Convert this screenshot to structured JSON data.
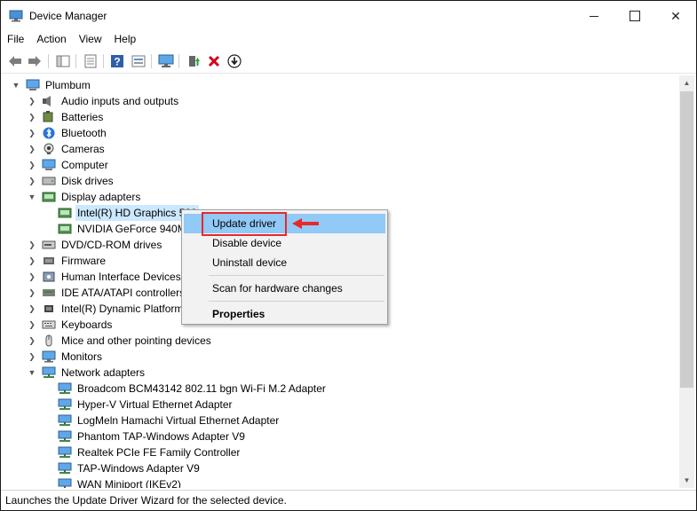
{
  "window": {
    "title": "Device Manager",
    "minimize_glyph": "",
    "maximize_glyph": "",
    "close_glyph": "✕"
  },
  "menu": [
    "File",
    "Action",
    "View",
    "Help"
  ],
  "toolbar": {
    "icons": [
      "back-icon",
      "forward-icon",
      "show-hide-tree-icon",
      "properties-icon",
      "help-icon",
      "view-icon",
      "scan-hardware-icon",
      "update-driver-icon",
      "uninstall-icon",
      "disable-icon"
    ]
  },
  "tree": {
    "root": "Plumbum",
    "categories": [
      {
        "label": "Audio inputs and outputs",
        "icon": "speaker-icon",
        "expanded": false
      },
      {
        "label": "Batteries",
        "icon": "battery-icon",
        "expanded": false
      },
      {
        "label": "Bluetooth",
        "icon": "bluetooth-icon",
        "expanded": false
      },
      {
        "label": "Cameras",
        "icon": "camera-icon",
        "expanded": false
      },
      {
        "label": "Computer",
        "icon": "computer-icon",
        "expanded": false
      },
      {
        "label": "Disk drives",
        "icon": "disk-icon",
        "expanded": false
      },
      {
        "label": "Display adapters",
        "icon": "display-adapter-icon",
        "expanded": true,
        "children": [
          "Intel(R) HD Graphics 520",
          "NVIDIA GeForce 940M"
        ]
      },
      {
        "label": "DVD/CD-ROM drives",
        "icon": "dvd-icon",
        "expanded": false
      },
      {
        "label": "Firmware",
        "icon": "firmware-icon",
        "expanded": false
      },
      {
        "label": "Human Interface Devices",
        "icon": "hid-icon",
        "expanded": false
      },
      {
        "label": "IDE ATA/ATAPI controllers",
        "icon": "ide-icon",
        "expanded": false
      },
      {
        "label": "Intel(R) Dynamic Platform",
        "icon": "chip-icon",
        "expanded": false
      },
      {
        "label": "Keyboards",
        "icon": "keyboard-icon",
        "expanded": false
      },
      {
        "label": "Mice and other pointing devices",
        "icon": "mouse-icon",
        "expanded": false
      },
      {
        "label": "Monitors",
        "icon": "monitor-icon",
        "expanded": false
      },
      {
        "label": "Network adapters",
        "icon": "network-icon",
        "expanded": true,
        "children": [
          "Broadcom BCM43142 802.11 bgn Wi-Fi M.2 Adapter",
          "Hyper-V Virtual Ethernet Adapter",
          "LogMeln Hamachi Virtual Ethernet Adapter",
          "Phantom TAP-Windows Adapter V9",
          "Realtek PCIe FE Family Controller",
          "TAP-Windows Adapter V9",
          "WAN Miniport (IKEv2)"
        ]
      }
    ],
    "selected_child_partial": "Intel(R) HD Graphics 520"
  },
  "context_menu": {
    "items": [
      "Update driver",
      "Disable device",
      "Uninstall device",
      "Scan for hardware changes",
      "Properties"
    ],
    "highlighted": "Update driver",
    "default": "Properties"
  },
  "status": "Launches the Update Driver Wizard for the selected device.",
  "colors": {
    "selection": "#cce8ff",
    "menu_highlight": "#91c9f7",
    "annotation_red": "#e8282b"
  }
}
